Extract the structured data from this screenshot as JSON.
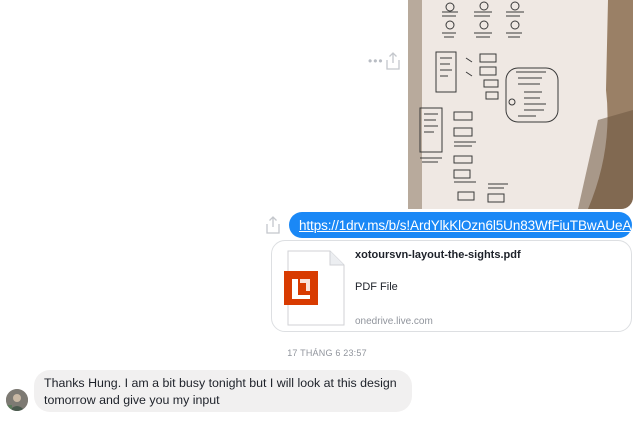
{
  "conversation": {
    "attachment_photo": {
      "icon": "sketch-photo"
    },
    "actions": {
      "more_icon": "ellipsis-icon",
      "share_icon": "share-icon"
    },
    "link_message": {
      "url": "https://1drv.ms/b/s!ArdYlkKlOzn6l5Un83WfFiuTBwAUeA"
    },
    "file_preview": {
      "file_name": "xotoursvn-layout-the-sights.pdf",
      "file_type": "PDF File",
      "host": "onedrive.live.com",
      "icon": "pdf-file-icon",
      "brand_color": "#d83b01"
    },
    "timestamp": "17 THÁNG 6 23:57",
    "reply_message": {
      "text": "Thanks Hung. I am a bit busy tonight but I will look at this design tomorrow and give you my input"
    },
    "colors": {
      "sent_bubble": "#1a88f6",
      "received_bubble": "#f1f0f0"
    }
  }
}
